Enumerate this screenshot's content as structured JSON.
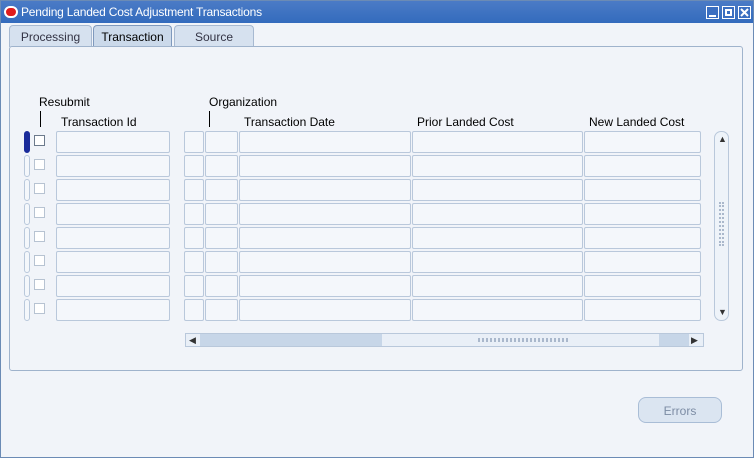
{
  "window": {
    "title": "Pending Landed Cost Adjustment Transactions"
  },
  "tabs": [
    {
      "label": "Processing",
      "active": false
    },
    {
      "label": "Transaction",
      "active": true
    },
    {
      "label": "Source",
      "active": false
    }
  ],
  "columns": {
    "resubmit": "Resubmit",
    "transaction_id": "Transaction Id",
    "organization": "Organization",
    "transaction_date": "Transaction Date",
    "prior_landed_cost": "Prior Landed Cost",
    "new_landed_cost": "New Landed Cost"
  },
  "rows": [
    {
      "resubmit": false,
      "transaction_id": "",
      "organization": "",
      "transaction_date": "",
      "prior_landed_cost": "",
      "new_landed_cost": ""
    },
    {
      "resubmit": false,
      "transaction_id": "",
      "organization": "",
      "transaction_date": "",
      "prior_landed_cost": "",
      "new_landed_cost": ""
    },
    {
      "resubmit": false,
      "transaction_id": "",
      "organization": "",
      "transaction_date": "",
      "prior_landed_cost": "",
      "new_landed_cost": ""
    },
    {
      "resubmit": false,
      "transaction_id": "",
      "organization": "",
      "transaction_date": "",
      "prior_landed_cost": "",
      "new_landed_cost": ""
    },
    {
      "resubmit": false,
      "transaction_id": "",
      "organization": "",
      "transaction_date": "",
      "prior_landed_cost": "",
      "new_landed_cost": ""
    },
    {
      "resubmit": false,
      "transaction_id": "",
      "organization": "",
      "transaction_date": "",
      "prior_landed_cost": "",
      "new_landed_cost": ""
    },
    {
      "resubmit": false,
      "transaction_id": "",
      "organization": "",
      "transaction_date": "",
      "prior_landed_cost": "",
      "new_landed_cost": ""
    },
    {
      "resubmit": false,
      "transaction_id": "",
      "organization": "",
      "transaction_date": "",
      "prior_landed_cost": "",
      "new_landed_cost": ""
    }
  ],
  "buttons": {
    "errors": "Errors"
  },
  "colors": {
    "titlebar": "#336bbd",
    "background": "#f1f4f9",
    "current_record": "#1a2b9a"
  }
}
